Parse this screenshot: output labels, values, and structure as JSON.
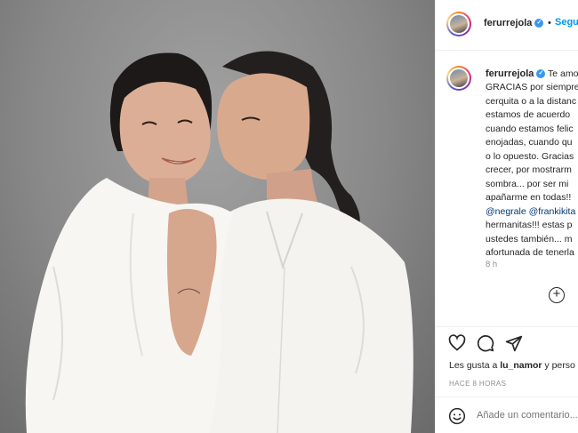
{
  "post": {
    "username": "ferurrejola",
    "verified_mark": "✓",
    "dot": "•",
    "follow_label": "Seguir",
    "caption_first": "Te amo",
    "caption_lines": [
      {
        "text": "GRACIAS por siempre",
        "type": "text"
      },
      {
        "text": "cerquita o a la distanc",
        "type": "text"
      },
      {
        "text": "estamos de acuerdo",
        "type": "text"
      },
      {
        "text": "cuando estamos felic",
        "type": "text"
      },
      {
        "text": "enojadas, cuando qu",
        "type": "text"
      },
      {
        "text": "o lo opuesto. Gracias",
        "type": "text"
      },
      {
        "text": "crecer, por mostrarm",
        "type": "text"
      },
      {
        "text": "sombra... por ser mi",
        "type": "text"
      },
      {
        "text": "apañarme en todas!!",
        "type": "text"
      },
      {
        "text": "@negrale @frankikita",
        "type": "mention"
      },
      {
        "text": "hermanitas!!! estas p",
        "type": "text"
      },
      {
        "text": "ustedes también... m",
        "type": "text"
      },
      {
        "text": "afortunada de tenerla",
        "type": "text"
      }
    ],
    "time_ago": "8 h",
    "add_reply_symbol": "+",
    "likes_prefix": "Les gusta a",
    "likes_user": "lu_namor",
    "likes_suffix": "y perso",
    "posted_time": "HACE 8 HORAS",
    "comment_placeholder": "Añade un comentario..."
  },
  "icons": {
    "verified": "verified-badge-icon",
    "heart": "heart-icon",
    "comment": "comment-icon",
    "share": "share-paper-plane-icon",
    "emoji": "emoji-smiley-icon",
    "add": "plus-circle-icon"
  },
  "colors": {
    "link": "#0095f6",
    "verified": "#3897f0",
    "muted": "#8e8e8e",
    "text": "#262626",
    "mention": "#00376b"
  }
}
